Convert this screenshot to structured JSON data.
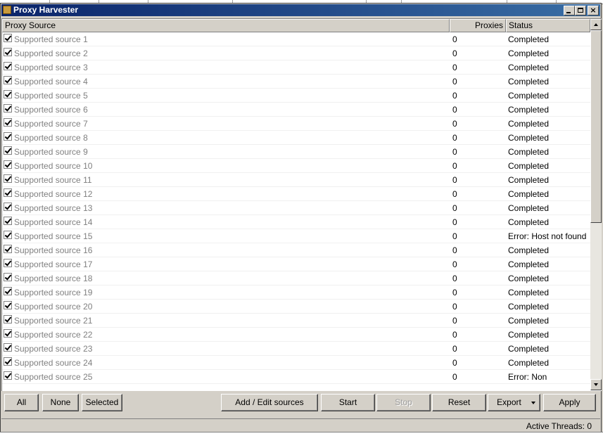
{
  "window": {
    "title": "Proxy Harvester",
    "controls": [
      "minimize",
      "maximize",
      "close"
    ]
  },
  "columns": {
    "source": "Proxy Source",
    "proxies": "Proxies",
    "status": "Status"
  },
  "rows": [
    {
      "source": "Supported source 1",
      "proxies": "0",
      "status": "Completed",
      "checked": true
    },
    {
      "source": "Supported source 2",
      "proxies": "0",
      "status": "Completed",
      "checked": true
    },
    {
      "source": "Supported source 3",
      "proxies": "0",
      "status": "Completed",
      "checked": true
    },
    {
      "source": "Supported source 4",
      "proxies": "0",
      "status": "Completed",
      "checked": true
    },
    {
      "source": "Supported source 5",
      "proxies": "0",
      "status": "Completed",
      "checked": true
    },
    {
      "source": "Supported source 6",
      "proxies": "0",
      "status": "Completed",
      "checked": true
    },
    {
      "source": "Supported source 7",
      "proxies": "0",
      "status": "Completed",
      "checked": true
    },
    {
      "source": "Supported source 8",
      "proxies": "0",
      "status": "Completed",
      "checked": true
    },
    {
      "source": "Supported source 9",
      "proxies": "0",
      "status": "Completed",
      "checked": true
    },
    {
      "source": "Supported source 10",
      "proxies": "0",
      "status": "Completed",
      "checked": true
    },
    {
      "source": "Supported source 11",
      "proxies": "0",
      "status": "Completed",
      "checked": true
    },
    {
      "source": "Supported source 12",
      "proxies": "0",
      "status": "Completed",
      "checked": true
    },
    {
      "source": "Supported source 13",
      "proxies": "0",
      "status": "Completed",
      "checked": true
    },
    {
      "source": "Supported source 14",
      "proxies": "0",
      "status": "Completed",
      "checked": true
    },
    {
      "source": "Supported source 15",
      "proxies": "0",
      "status": "Error: Host not found",
      "checked": true
    },
    {
      "source": "Supported source 16",
      "proxies": "0",
      "status": "Completed",
      "checked": true
    },
    {
      "source": "Supported source 17",
      "proxies": "0",
      "status": "Completed",
      "checked": true
    },
    {
      "source": "Supported source 18",
      "proxies": "0",
      "status": "Completed",
      "checked": true
    },
    {
      "source": "Supported source 19",
      "proxies": "0",
      "status": "Completed",
      "checked": true
    },
    {
      "source": "Supported source 20",
      "proxies": "0",
      "status": "Completed",
      "checked": true
    },
    {
      "source": "Supported source 21",
      "proxies": "0",
      "status": "Completed",
      "checked": true
    },
    {
      "source": "Supported source 22",
      "proxies": "0",
      "status": "Completed",
      "checked": true
    },
    {
      "source": "Supported source 23",
      "proxies": "0",
      "status": "Completed",
      "checked": true
    },
    {
      "source": "Supported source 24",
      "proxies": "0",
      "status": "Completed",
      "checked": true
    },
    {
      "source": "Supported source 25",
      "proxies": "0",
      "status": "Error: Non",
      "checked": true
    }
  ],
  "buttons": {
    "all": "All",
    "none": "None",
    "selected": "Selected",
    "add_edit": "Add / Edit sources",
    "start": "Start",
    "stop": "Stop",
    "reset": "Reset",
    "export": "Export",
    "apply": "Apply"
  },
  "status_bar": {
    "active_threads": "Active Threads: 0"
  },
  "colors": {
    "titlebar_start": "#0a246a",
    "titlebar_end": "#3a6ea5",
    "face": "#d4d0c8",
    "disabled_text": "#808080"
  }
}
